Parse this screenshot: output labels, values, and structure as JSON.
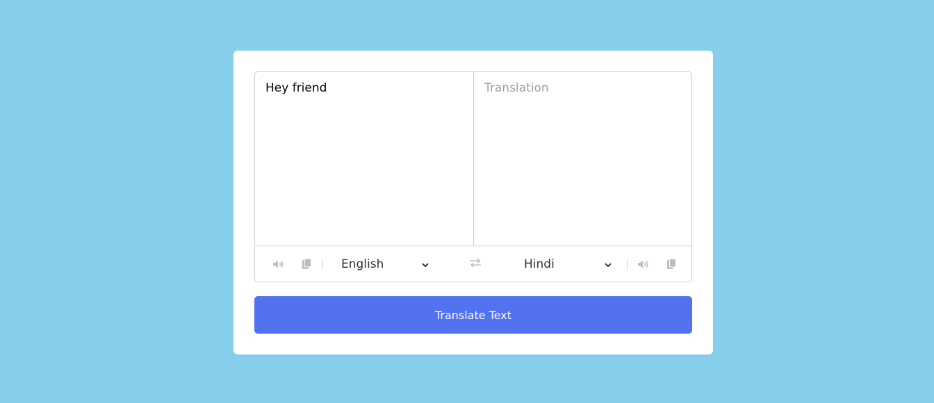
{
  "translator": {
    "from_text": "Hey friend",
    "to_placeholder": "Translation",
    "from_language": "English",
    "to_language": "Hindi",
    "translate_button": "Translate Text"
  },
  "icons": {
    "from_speak": "volume-icon",
    "from_copy": "copy-icon",
    "exchange": "exchange-icon",
    "to_speak": "volume-icon",
    "to_copy": "copy-icon"
  },
  "colors": {
    "background": "#87ceeb",
    "button": "#5372f0",
    "icon": "#bdbdbd"
  }
}
